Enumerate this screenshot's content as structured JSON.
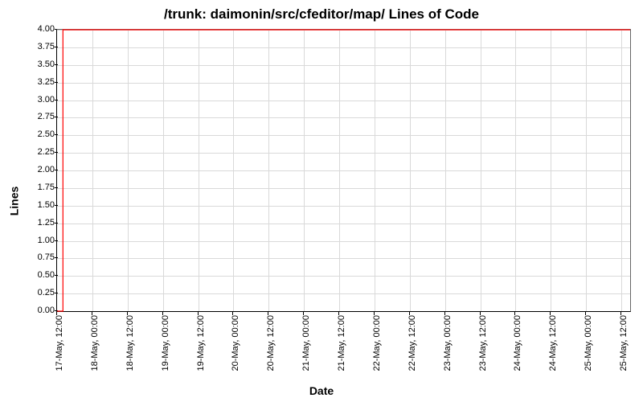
{
  "chart_data": {
    "type": "line",
    "title": "/trunk: daimonin/src/cfeditor/map/ Lines of Code",
    "xlabel": "Date",
    "ylabel": "Lines",
    "ylim": [
      0,
      4.0
    ],
    "yticks": [
      0.0,
      0.25,
      0.5,
      0.75,
      1.0,
      1.25,
      1.5,
      1.75,
      2.0,
      2.25,
      2.5,
      2.75,
      3.0,
      3.25,
      3.5,
      3.75,
      4.0
    ],
    "xticks": [
      "17-May, 12:00",
      "18-May, 00:00",
      "18-May, 12:00",
      "19-May, 00:00",
      "19-May, 12:00",
      "20-May, 00:00",
      "20-May, 12:00",
      "21-May, 00:00",
      "21-May, 12:00",
      "22-May, 00:00",
      "22-May, 12:00",
      "23-May, 00:00",
      "23-May, 12:00",
      "24-May, 00:00",
      "24-May, 12:00",
      "25-May, 00:00",
      "25-May, 12:00"
    ],
    "x_range_hours": [
      0,
      195
    ],
    "series": [
      {
        "name": "lines",
        "color": "#ff0000",
        "points": [
          {
            "x_hours": 0,
            "y": 0
          },
          {
            "x_hours": 2,
            "y": 0
          },
          {
            "x_hours": 2,
            "y": 4
          },
          {
            "x_hours": 195,
            "y": 4
          }
        ]
      }
    ]
  }
}
